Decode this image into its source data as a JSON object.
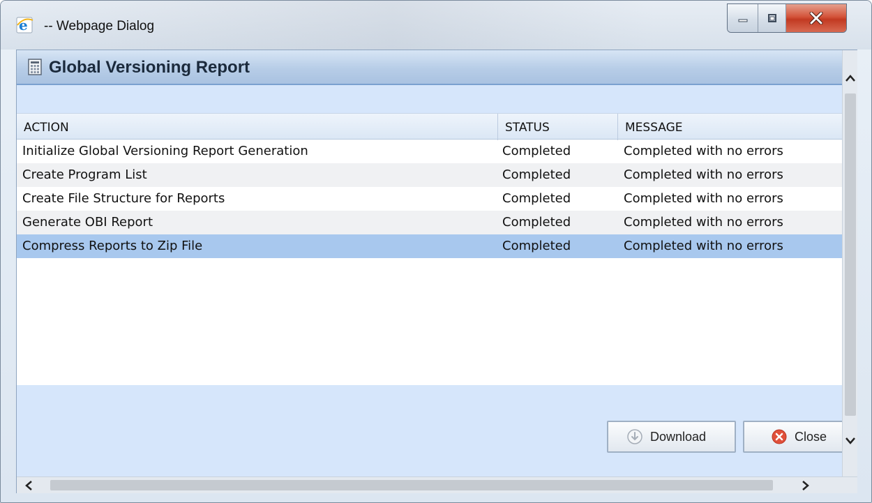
{
  "window": {
    "title": "-- Webpage Dialog",
    "icon": "internet-explorer-icon"
  },
  "panel": {
    "title": "Global Versioning Report",
    "icon": "report-icon"
  },
  "table": {
    "columns": [
      "ACTION",
      "STATUS",
      "MESSAGE"
    ],
    "rows": [
      {
        "action": "Initialize Global Versioning Report Generation",
        "status": "Completed",
        "message": "Completed with no errors"
      },
      {
        "action": "Create Program List",
        "status": "Completed",
        "message": "Completed with no errors"
      },
      {
        "action": "Create File Structure for Reports",
        "status": "Completed",
        "message": "Completed with no errors"
      },
      {
        "action": "Generate OBI Report",
        "status": "Completed",
        "message": "Completed with no errors"
      },
      {
        "action": "Compress Reports to Zip File",
        "status": "Completed",
        "message": "Completed with no errors"
      }
    ],
    "selected_row": 4
  },
  "buttons": {
    "download_label": "Download",
    "close_label": "Close"
  },
  "colors": {
    "header_accent": "#a9c2e1",
    "selection": "#a8c8ee",
    "close_red": "#d4543a"
  }
}
